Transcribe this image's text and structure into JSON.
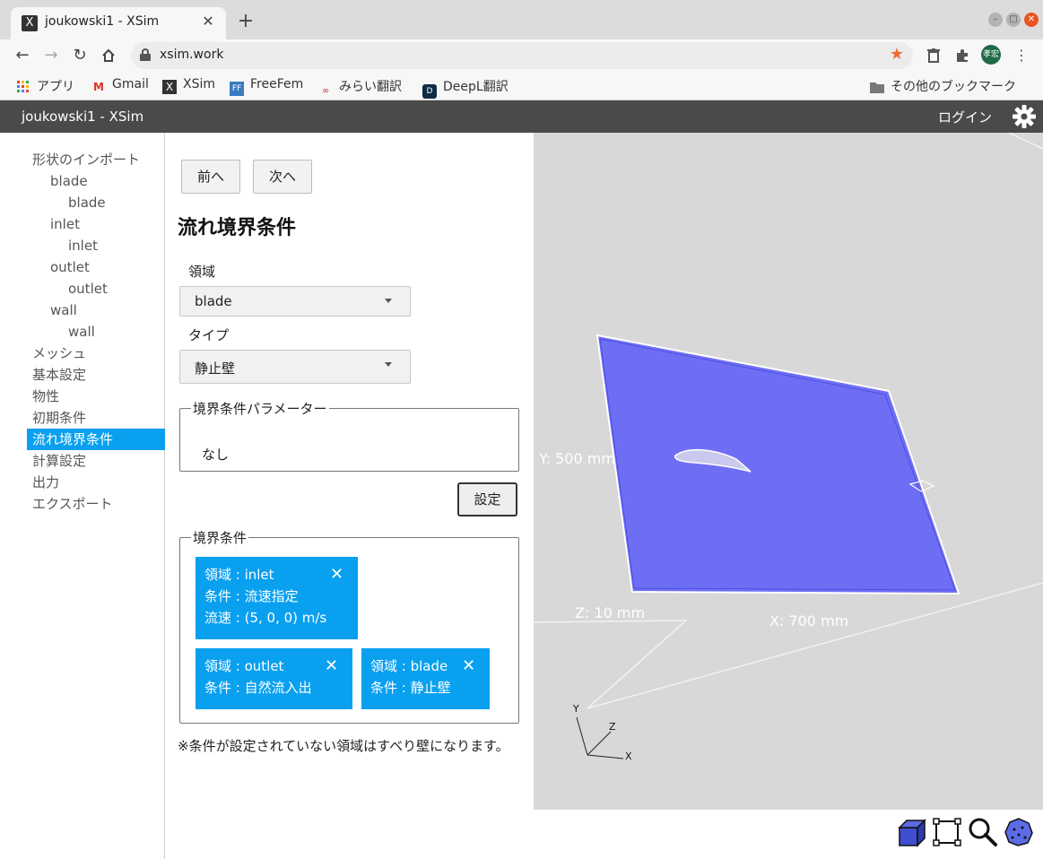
{
  "browser": {
    "tab_title": "joukowski1 - XSim",
    "tab_favicon": "X",
    "url": "xsim.work",
    "profile_initials": "孝宏",
    "bookmarks": [
      {
        "label": "アプリ",
        "icon": "apps-grid-icon"
      },
      {
        "label": "Gmail",
        "icon": "gmail-icon"
      },
      {
        "label": "XSim",
        "icon": "xsim-icon"
      },
      {
        "label": "FreeFem",
        "icon": "freefem-icon"
      },
      {
        "label": "みらい翻訳",
        "icon": "mirai-icon"
      },
      {
        "label": "DeepL翻訳",
        "icon": "deepl-icon"
      }
    ],
    "other_bookmarks": "その他のブックマーク"
  },
  "app": {
    "title": "joukowski1 - XSim",
    "login_label": "ログイン"
  },
  "sidebar": {
    "items": [
      {
        "label": "形状のインポート",
        "level": 0
      },
      {
        "label": "blade",
        "level": 1
      },
      {
        "label": "blade",
        "level": 2
      },
      {
        "label": "inlet",
        "level": 1
      },
      {
        "label": "inlet",
        "level": 2
      },
      {
        "label": "outlet",
        "level": 1
      },
      {
        "label": "outlet",
        "level": 2
      },
      {
        "label": "wall",
        "level": 1
      },
      {
        "label": "wall",
        "level": 2
      },
      {
        "label": "メッシュ",
        "level": 0
      },
      {
        "label": "基本設定",
        "level": 0
      },
      {
        "label": "物性",
        "level": 0
      },
      {
        "label": "初期条件",
        "level": 0
      },
      {
        "label": "流れ境界条件",
        "level": 0,
        "active": true
      },
      {
        "label": "計算設定",
        "level": 0
      },
      {
        "label": "出力",
        "level": 0
      },
      {
        "label": "エクスポート",
        "level": 0
      }
    ]
  },
  "form": {
    "prev_label": "前へ",
    "next_label": "次へ",
    "title": "流れ境界条件",
    "region_label": "領域",
    "region_value": "blade",
    "type_label": "タイプ",
    "type_value": "静止壁",
    "params_legend": "境界条件パラメーター",
    "params_value": "なし",
    "set_label": "設定",
    "conditions_legend": "境界条件",
    "conditions": [
      {
        "lines": [
          "領域 : inlet",
          "条件 : 流速指定",
          "流速 : (5, 0, 0) m/s"
        ]
      },
      {
        "lines": [
          "領域 : outlet",
          "条件 : 自然流入出"
        ]
      },
      {
        "lines": [
          "領域 : blade",
          "条件 : 静止壁"
        ]
      }
    ],
    "note": "※条件が設定されていない領域はすべり壁になります。"
  },
  "viewport": {
    "y_dim": "Y: 500 mm",
    "z_dim": "Z: 10 mm",
    "x_dim": "X: 700 mm",
    "axis_x": "X",
    "axis_y": "Y",
    "axis_z": "Z",
    "plate_color": "#6e6ef5",
    "tools": [
      "solid-view-icon",
      "fit-view-icon",
      "zoom-icon",
      "mesh-view-icon"
    ]
  }
}
